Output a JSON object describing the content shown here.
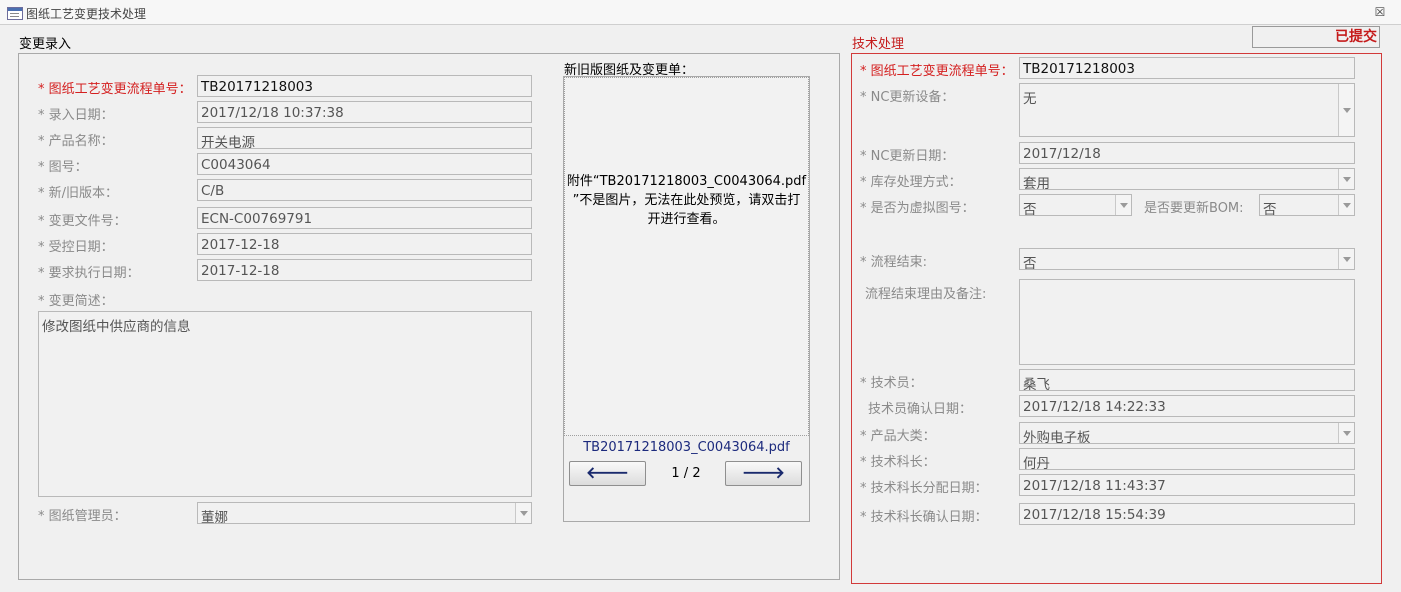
{
  "window": {
    "title": "图纸工艺变更技术处理",
    "close": "☒"
  },
  "left_section": {
    "title": "变更录入",
    "fields": {
      "process_no": {
        "label": "* 图纸工艺变更流程单号：",
        "value": "TB20171218003"
      },
      "entry_date": {
        "label": "* 录入日期：",
        "value": "2017/12/18 10:37:38"
      },
      "product_name": {
        "label": "* 产品名称：",
        "value": "开关电源"
      },
      "drawing_no": {
        "label": "* 图号：",
        "value": "C0043064"
      },
      "version": {
        "label": "* 新/旧版本：",
        "value": "C/B"
      },
      "change_doc_no": {
        "label": "* 变更文件号：",
        "value": "ECN-C00769791"
      },
      "controlled_date": {
        "label": "* 受控日期：",
        "value": "2017-12-18"
      },
      "required_exec_date": {
        "label": "* 要求执行日期：",
        "value": "2017-12-18"
      },
      "change_summary": {
        "label": "* 变更简述：",
        "value": "修改图纸中供应商的信息"
      },
      "drawing_admin": {
        "label": "* 图纸管理员：",
        "value": "董娜"
      }
    }
  },
  "preview": {
    "title": "新旧版图纸及变更单：",
    "message_line1": "附件“TB20171218003_C0043064.pdf",
    "message_line2": "”不是图片，无法在此处预览，请双击打",
    "message_line3": "开进行查看。",
    "filename": "TB20171218003_C0043064.pdf",
    "page_indicator": "1 / 2",
    "prev_glyph": "🡐",
    "next_glyph": "🡒"
  },
  "right_section": {
    "title": "技术处理",
    "status_badge": "已提交",
    "fields": {
      "process_no": {
        "label": "* 图纸工艺变更流程单号：",
        "value": "TB20171218003"
      },
      "nc_device": {
        "label": "*  NC更新设备：",
        "value": "无"
      },
      "nc_update_date": {
        "label": "* NC更新日期：",
        "value": "2017/12/18"
      },
      "stock_method": {
        "label": "* 库存处理方式：",
        "value": "套用"
      },
      "virtual_drawing": {
        "label": "* 是否为虚拟图号：",
        "value": "否"
      },
      "update_bom": {
        "label": "是否要更新BOM:",
        "value": "否"
      },
      "process_end": {
        "label": "* 流程结束:",
        "value": "否"
      },
      "end_reason": {
        "label": "流程结束理由及备注:",
        "value": ""
      },
      "technician": {
        "label": "* 技术员：",
        "value": "桑飞"
      },
      "tech_confirm_date": {
        "label": "技术员确认日期：",
        "value": "2017/12/18 14:22:33"
      },
      "product_category": {
        "label": "* 产品大类：",
        "value": "外购电子板"
      },
      "section_chief": {
        "label": "* 技术科长：",
        "value": "何丹"
      },
      "chief_assign_date": {
        "label": "* 技术科长分配日期：",
        "value": "2017/12/18 11:43:37"
      },
      "chief_confirm_date": {
        "label": "* 技术科长确认日期：",
        "value": "2017/12/18 15:54:39"
      }
    }
  }
}
